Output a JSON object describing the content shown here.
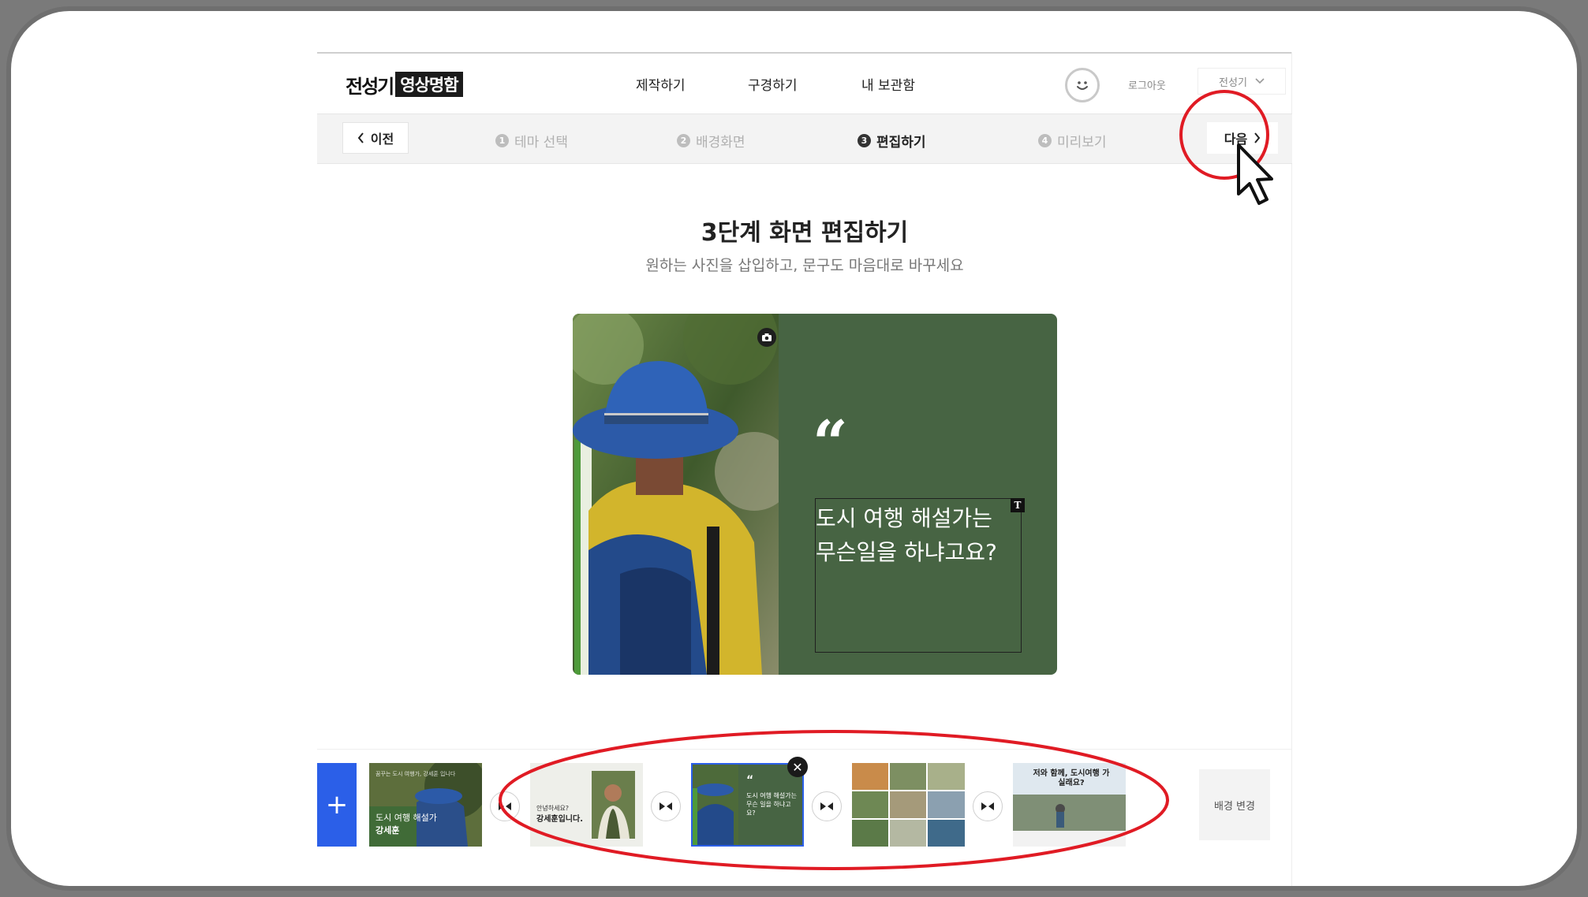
{
  "header": {
    "logo_part1": "전성기",
    "logo_part2": "영상명함",
    "nav": [
      "제작하기",
      "구경하기",
      "내 보관함"
    ],
    "logout_label": "로그아웃",
    "user_name": "전성기"
  },
  "steps": {
    "prev_label": "이전",
    "next_label": "다음",
    "items": [
      {
        "num": "1",
        "label": "테마 선택"
      },
      {
        "num": "2",
        "label": "배경화면"
      },
      {
        "num": "3",
        "label": "편집하기"
      },
      {
        "num": "4",
        "label": "미리보기"
      }
    ]
  },
  "main": {
    "title": "3단계 화면 편집하기",
    "subtitle": "원하는 사진을 삽입하고, 문구도 마음대로 바꾸세요"
  },
  "card": {
    "quote_mark": "“",
    "text_line1": "도시 여행 해설가는",
    "text_line2": "무슨일을 하냐고요?",
    "text_badge": "T",
    "bg_color": "#476443"
  },
  "strip": {
    "add_label": "+",
    "background_change_label": "배경 변경",
    "thumb1_small": "꿈꾸는 도시 여행가, 강세훈 입니다",
    "thumb1_main": "도시 여행 해설가",
    "thumb1_name": "강세훈",
    "thumb2_small": "안녕하세요?",
    "thumb2_main": "강세훈입니다.",
    "thumb3_main": "도시 여행 해설가는 무슨 일을 하냐고요?",
    "thumb5_main": "저와 함께, 도시여행 가실래요?",
    "close_label": "✕"
  },
  "colors": {
    "accent_blue": "#2b5fe8",
    "annotation_red": "#e01b24"
  }
}
